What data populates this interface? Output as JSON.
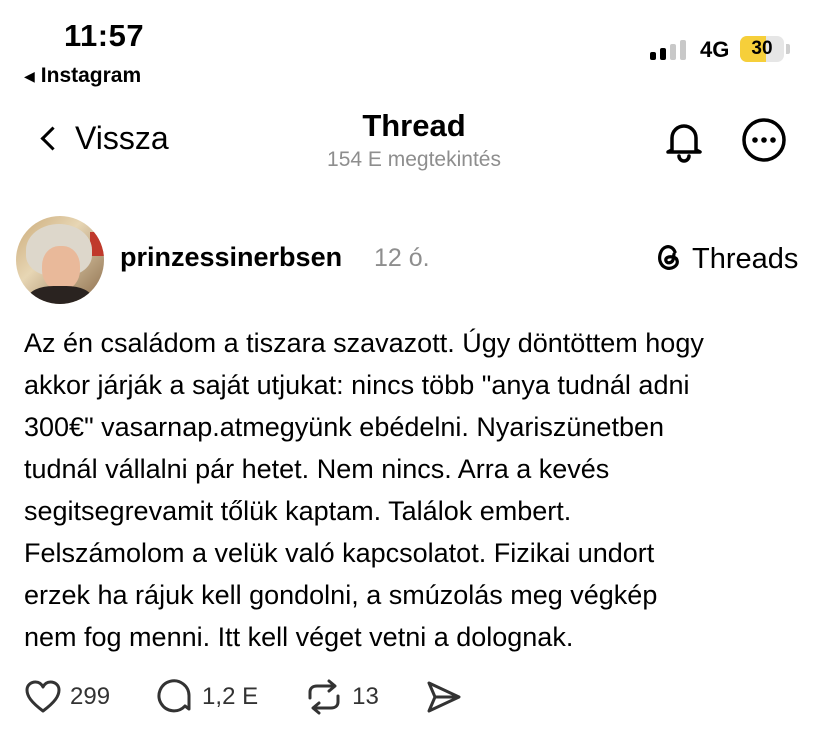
{
  "status_bar": {
    "time": "11:57",
    "back_app": "Instagram",
    "network": "4G",
    "battery_level": "30",
    "battery_color": "#f6cf3a"
  },
  "header": {
    "back_label": "Vissza",
    "title": "Thread",
    "subtitle": "154 E megtekintés"
  },
  "post": {
    "username": "prinzessinerbsen",
    "time_ago": "12 ó.",
    "brand_label": "Threads",
    "lines": [
      "Az én családom a tiszara szavazott. Úgy döntöttem hogy",
      "akkor járják a saját utjukat: nincs több \"anya tudnál adni",
      "300€\" vasarnap.atmegyünk ebédelni. Nyariszünetben",
      "tudnál vállalni pár hetet. Nem  nincs. Arra a kevés",
      "segitsegrevamit tőlük kaptam. Találok embert.",
      "Felszámolom a velük való kapcsolatot. Fizikai undort",
      "erzek ha rájuk kell gondolni, a smúzolás meg végkép",
      "nem fog menni. Itt kell véget vetni a dolognak."
    ],
    "actions": {
      "likes": "299",
      "comments": "1,2 E",
      "reposts": "13"
    }
  },
  "icons": {
    "back_app": "triangle-left-icon",
    "back": "chevron-left-icon",
    "notifications": "bell-icon",
    "more": "more-icon",
    "brand": "threads-logo-icon",
    "like": "heart-icon",
    "comment": "comment-icon",
    "repost": "repost-icon",
    "share": "send-icon"
  }
}
